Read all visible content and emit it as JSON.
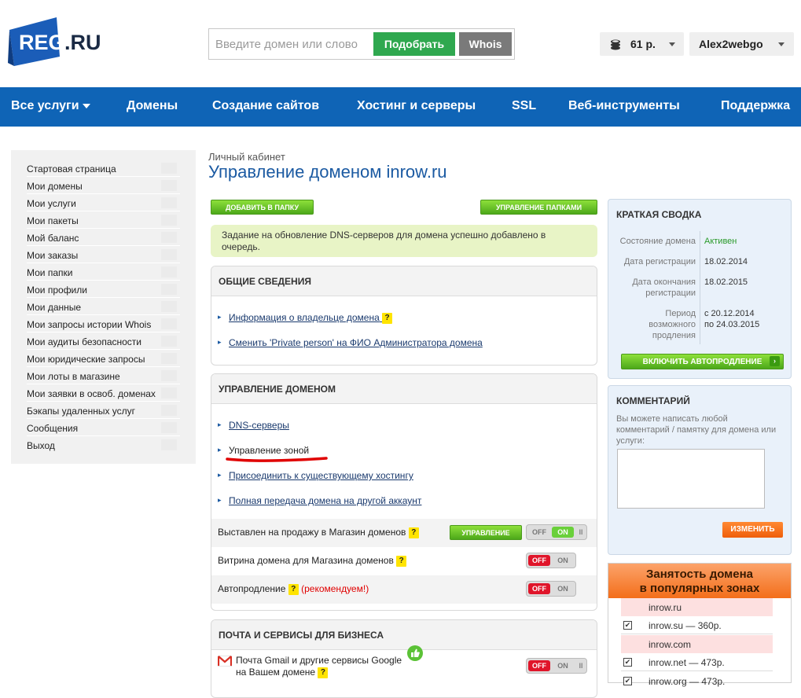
{
  "header": {
    "logo_text": "REG",
    "logo_suffix": ".RU",
    "search_placeholder": "Введите домен или слово",
    "pick_label": "Подобрать",
    "whois_label": "Whois",
    "balance": "61 р.",
    "username": "Alex2webgo"
  },
  "nav": {
    "items": [
      "Все услуги",
      "Домены",
      "Создание сайтов",
      "Хостинг и серверы",
      "SSL",
      "Веб-инструменты",
      "Поддержка"
    ]
  },
  "sidebar": {
    "items": [
      "Стартовая страница",
      "Мои домены",
      "Мои услуги",
      "Мои пакеты",
      "Мой баланс",
      "Мои заказы",
      "Мои папки",
      "Мои профили",
      "Мои данные",
      "Мои запросы истории Whois",
      "Мои аудиты безопасности",
      "Мои юридические запросы",
      "Мои лоты в магазине",
      "Мои заявки в освоб. доменах",
      "Бэкапы удаленных услуг",
      "Сообщения",
      "Выход"
    ]
  },
  "page": {
    "breadcrumb": "Личный кабинет",
    "title": "Управление доменом inrow.ru",
    "add_folder": "ДОБАВИТЬ В ПАПКУ",
    "manage_folders": "УПРАВЛЕНИЕ ПАПКАМИ",
    "notice": "Задание на обновление DNS-серверов для домена успешно добавлено в очередь."
  },
  "general": {
    "title": "ОБЩИЕ СВЕДЕНИЯ",
    "link1": "Информация о владельце домена",
    "link2": "Сменить 'Private person' на ФИО Администратора домена"
  },
  "manage": {
    "title": "УПРАВЛЕНИЕ ДОМЕНОМ",
    "links": [
      "DNS-серверы",
      "Управление зоной",
      "Присоединить к существующему хостингу",
      "Полная передача домена на другой аккаунт"
    ],
    "row1": "Выставлен на продажу в Магазин доменов",
    "row1_button": "УПРАВЛЕНИЕ",
    "row2": "Витрина домена для Магазина доменов",
    "row3": "Автопродление",
    "row3_note": "(рекомендуем!)"
  },
  "mail": {
    "title": "ПОЧТА И СЕРВИСЫ ДЛЯ БИЗНЕСА",
    "line1": "Почта Gmail и другие сервисы Google",
    "line2": "на Вашем домене"
  },
  "toggles": {
    "off": "OFF",
    "on": "ON",
    "bars": "II"
  },
  "summary": {
    "title": "КРАТКАЯ СВОДКА",
    "status_label": "Состояние домена",
    "status_value": "Активен",
    "reg_label": "Дата регистрации",
    "reg_value": "18.02.2014",
    "end_label_1": "Дата окончания",
    "end_label_2": "регистрации",
    "end_value": "18.02.2015",
    "renew_label_1": "Период",
    "renew_label_2": "возможного",
    "renew_label_3": "продления",
    "renew_value_1": "с 20.12.2014",
    "renew_value_2": "по 24.03.2015",
    "autorenew_button": "ВКЛЮЧИТЬ АВТОПРОДЛЕНИЕ"
  },
  "comment": {
    "title": "КОММЕНТАРИЙ",
    "hint": "Вы можете написать любой комментарий / памятку для домена или услуги:",
    "button": "ИЗМЕНИТЬ"
  },
  "occupancy": {
    "title_1": "Занятость домена",
    "title_2": "в популярных зонах",
    "rows": [
      "inrow.ru",
      "inrow.su — 360р.",
      "inrow.com",
      "inrow.net — 473р.",
      "inrow.org — 473р."
    ]
  }
}
